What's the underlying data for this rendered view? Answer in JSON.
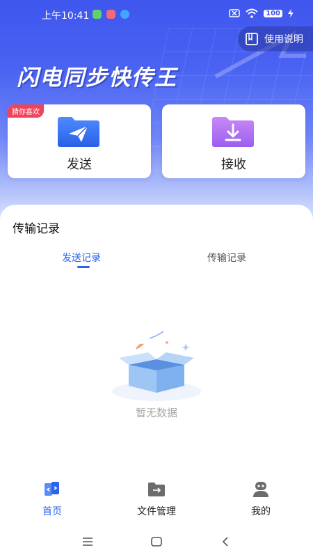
{
  "status_bar": {
    "time": "上午10:41",
    "battery": "100"
  },
  "header": {
    "help_button": "使用说明",
    "app_title": "闪电同步快传王"
  },
  "cards": {
    "send": {
      "label": "发送",
      "badge": "猜你喜欢"
    },
    "receive": {
      "label": "接收"
    }
  },
  "records": {
    "title": "传输记录",
    "tabs": [
      {
        "label": "发送记录",
        "active": true
      },
      {
        "label": "传输记录",
        "active": false
      }
    ],
    "empty_text": "暂无数据"
  },
  "bottom_nav": {
    "items": [
      {
        "label": "首页",
        "icon": "home-transfer-icon",
        "active": true
      },
      {
        "label": "文件管理",
        "icon": "folder-icon",
        "active": false
      },
      {
        "label": "我的",
        "icon": "profile-icon",
        "active": false
      }
    ]
  },
  "colors": {
    "primary": "#2a63f0",
    "hero": "#3f56ee",
    "badge": "#f0445a"
  }
}
